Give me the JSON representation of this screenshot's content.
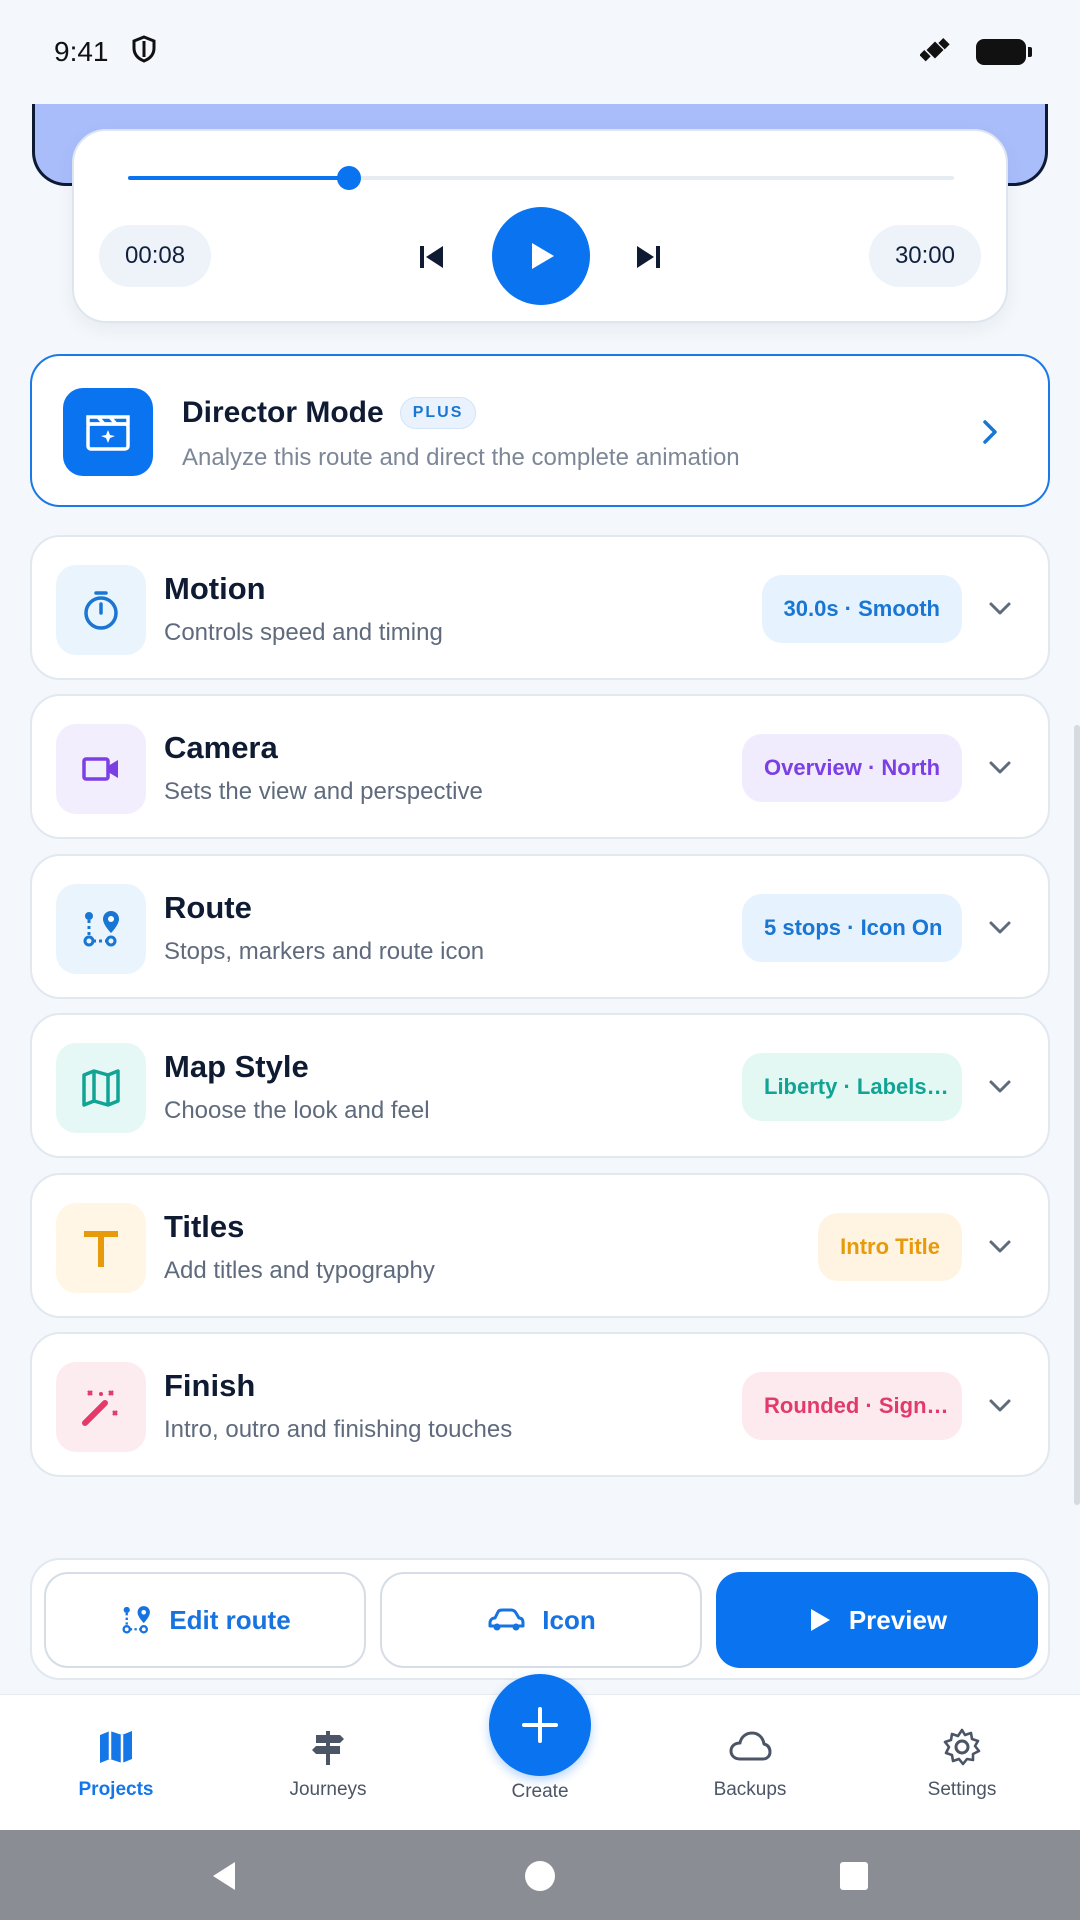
{
  "status_bar": {
    "time": "9:41"
  },
  "player": {
    "current_time": "00:08",
    "total_time": "30:00",
    "progress_fraction": 0.267
  },
  "director": {
    "title": "Director Mode",
    "badge": "PLUS",
    "subtitle": "Analyze this route and direct the complete animation"
  },
  "sections": [
    {
      "title": "Motion",
      "subtitle": "Controls speed and timing",
      "summary": "30.0s · Smooth",
      "icon": "stopwatch-icon",
      "color": "#1976d2",
      "bg": "#eaf4fd",
      "pill_bg": "#e6f2fd"
    },
    {
      "title": "Camera",
      "subtitle": "Sets the view and perspective",
      "summary": "Overview · North",
      "icon": "video-camera-icon",
      "color": "#7b3fe4",
      "bg": "#f2eefd",
      "pill_bg": "#f1ecfd"
    },
    {
      "title": "Route",
      "subtitle": "Stops, markers and route icon",
      "summary": "5 stops · Icon On",
      "icon": "route-icon",
      "color": "#1976d2",
      "bg": "#eaf4fd",
      "pill_bg": "#e6f2fd"
    },
    {
      "title": "Map Style",
      "subtitle": "Choose the look and feel",
      "summary": "Liberty · Labels…",
      "icon": "map-icon",
      "color": "#11a393",
      "bg": "#e6f8f5",
      "pill_bg": "#e3f7f3"
    },
    {
      "title": "Titles",
      "subtitle": "Add titles and typography",
      "summary": "Intro Title",
      "icon": "title-t-icon",
      "color": "#e79a0c",
      "bg": "#fff6e6",
      "pill_bg": "#fff4e1"
    },
    {
      "title": "Finish",
      "subtitle": "Intro, outro and finishing touches",
      "summary": "Rounded · Sign…",
      "icon": "magic-wand-icon",
      "color": "#e23a6b",
      "bg": "#fdecef",
      "pill_bg": "#fdeaee"
    }
  ],
  "actions": {
    "edit_route": "Edit route",
    "icon": "Icon",
    "preview": "Preview"
  },
  "nav": {
    "items": [
      "Projects",
      "Journeys",
      "Create",
      "Backups",
      "Settings"
    ],
    "active": "Projects"
  },
  "colors": {
    "accent": "#0a73f0"
  }
}
